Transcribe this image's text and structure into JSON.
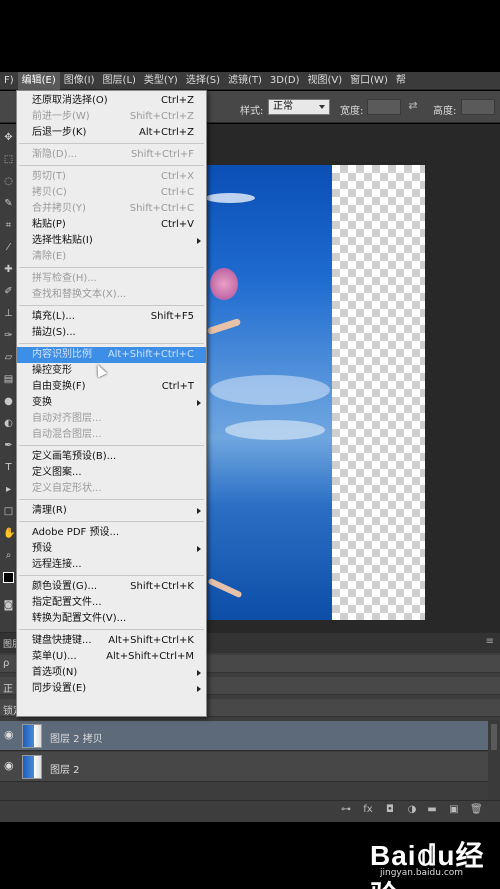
{
  "menubar": {
    "items": [
      "F)",
      "编辑(E)",
      "图像(I)",
      "图层(L)",
      "类型(Y)",
      "选择(S)",
      "滤镜(T)",
      "3D(D)",
      "视图(V)",
      "窗口(W)",
      "帮"
    ],
    "active_index": 1
  },
  "options": {
    "style_label": "样式:",
    "style_value": "正常",
    "width_label": "宽度:",
    "height_label": "高度:"
  },
  "edit_menu": {
    "items": [
      {
        "label": "还原取消选择(O)",
        "shortcut": "Ctrl+Z",
        "enabled": true
      },
      {
        "label": "前进一步(W)",
        "shortcut": "Shift+Ctrl+Z",
        "enabled": false
      },
      {
        "label": "后退一步(K)",
        "shortcut": "Alt+Ctrl+Z",
        "enabled": true
      },
      {
        "sep": true
      },
      {
        "label": "渐隐(D)...",
        "shortcut": "Shift+Ctrl+F",
        "enabled": false
      },
      {
        "sep": true
      },
      {
        "label": "剪切(T)",
        "shortcut": "Ctrl+X",
        "enabled": false
      },
      {
        "label": "拷贝(C)",
        "shortcut": "Ctrl+C",
        "enabled": false
      },
      {
        "label": "合并拷贝(Y)",
        "shortcut": "Shift+Ctrl+C",
        "enabled": false
      },
      {
        "label": "粘贴(P)",
        "shortcut": "Ctrl+V",
        "enabled": true
      },
      {
        "label": "选择性粘贴(I)",
        "shortcut": "",
        "enabled": true,
        "submenu": true
      },
      {
        "label": "清除(E)",
        "shortcut": "",
        "enabled": false
      },
      {
        "sep": true
      },
      {
        "label": "拼写检查(H)...",
        "shortcut": "",
        "enabled": false
      },
      {
        "label": "查找和替换文本(X)...",
        "shortcut": "",
        "enabled": false
      },
      {
        "sep": true
      },
      {
        "label": "填充(L)...",
        "shortcut": "Shift+F5",
        "enabled": true
      },
      {
        "label": "描边(S)...",
        "shortcut": "",
        "enabled": true
      },
      {
        "sep": true
      },
      {
        "label": "内容识别比例",
        "shortcut": "Alt+Shift+Ctrl+C",
        "enabled": true,
        "highlight": true
      },
      {
        "label": "操控变形",
        "shortcut": "",
        "enabled": true
      },
      {
        "label": "自由变换(F)",
        "shortcut": "Ctrl+T",
        "enabled": true
      },
      {
        "label": "变换",
        "shortcut": "",
        "enabled": true,
        "submenu": true
      },
      {
        "label": "自动对齐图层...",
        "shortcut": "",
        "enabled": false
      },
      {
        "label": "自动混合图层...",
        "shortcut": "",
        "enabled": false
      },
      {
        "sep": true
      },
      {
        "label": "定义画笔预设(B)...",
        "shortcut": "",
        "enabled": true
      },
      {
        "label": "定义图案...",
        "shortcut": "",
        "enabled": true
      },
      {
        "label": "定义自定形状...",
        "shortcut": "",
        "enabled": false
      },
      {
        "sep": true
      },
      {
        "label": "清理(R)",
        "shortcut": "",
        "enabled": true,
        "submenu": true
      },
      {
        "sep": true
      },
      {
        "label": "Adobe PDF 预设...",
        "shortcut": "",
        "enabled": true
      },
      {
        "label": "预设",
        "shortcut": "",
        "enabled": true,
        "submenu": true
      },
      {
        "label": "远程连接...",
        "shortcut": "",
        "enabled": true
      },
      {
        "sep": true
      },
      {
        "label": "颜色设置(G)...",
        "shortcut": "Shift+Ctrl+K",
        "enabled": true
      },
      {
        "label": "指定配置文件...",
        "shortcut": "",
        "enabled": true
      },
      {
        "label": "转换为配置文件(V)...",
        "shortcut": "",
        "enabled": true
      },
      {
        "sep": true
      },
      {
        "label": "键盘快捷键...",
        "shortcut": "Alt+Shift+Ctrl+K",
        "enabled": true
      },
      {
        "label": "菜单(U)...",
        "shortcut": "Alt+Shift+Ctrl+M",
        "enabled": true
      },
      {
        "label": "首选项(N)",
        "shortcut": "",
        "enabled": true,
        "submenu": true
      },
      {
        "label": "同步设置(E)",
        "shortcut": "",
        "enabled": true,
        "submenu": true
      }
    ]
  },
  "panels": {
    "tab_label": "图层",
    "kind_label": "ρ",
    "mode_label": "正",
    "lock_label": "锁定"
  },
  "layers": [
    {
      "name": "图层 2 拷贝",
      "selected": true
    },
    {
      "name": "图层 2",
      "selected": false
    }
  ],
  "watermark": {
    "brand": "Bai𝕕u经验",
    "url": "jingyan.baidu.com"
  }
}
